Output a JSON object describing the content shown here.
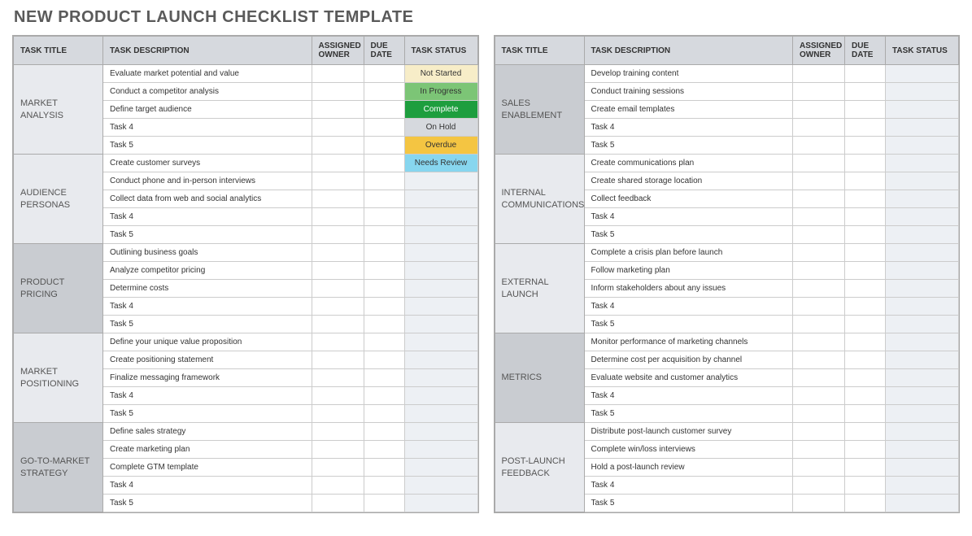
{
  "title": "NEW PRODUCT LAUNCH CHECKLIST TEMPLATE",
  "headers": {
    "task_title": "TASK TITLE",
    "task_desc": "TASK DESCRIPTION",
    "owner": "ASSIGNED OWNER",
    "due": "DUE DATE",
    "status": "TASK STATUS"
  },
  "status_labels": {
    "not_started": "Not Started",
    "in_progress": "In Progress",
    "complete": "Complete",
    "on_hold": "On Hold",
    "overdue": "Overdue",
    "needs_review": "Needs Review"
  },
  "left_sections": [
    {
      "title": "MARKET ANALYSIS",
      "alt": false,
      "tasks": [
        {
          "desc": "Evaluate market potential and value",
          "status": "not_started"
        },
        {
          "desc": "Conduct a competitor analysis",
          "status": "in_progress"
        },
        {
          "desc": "Define target audience",
          "status": "complete"
        },
        {
          "desc": "Task 4",
          "status": "on_hold"
        },
        {
          "desc": "Task 5",
          "status": "overdue"
        }
      ]
    },
    {
      "title": "AUDIENCE PERSONAS",
      "alt": false,
      "tasks": [
        {
          "desc": "Create customer surveys",
          "status": "needs_review"
        },
        {
          "desc": "Conduct phone and in-person interviews",
          "status": ""
        },
        {
          "desc": "Collect data from web and social analytics",
          "status": ""
        },
        {
          "desc": "Task 4",
          "status": ""
        },
        {
          "desc": "Task 5",
          "status": ""
        }
      ]
    },
    {
      "title": "PRODUCT PRICING",
      "alt": true,
      "tasks": [
        {
          "desc": "Outlining business goals",
          "status": ""
        },
        {
          "desc": "Analyze competitor pricing",
          "status": ""
        },
        {
          "desc": "Determine costs",
          "status": ""
        },
        {
          "desc": "Task 4",
          "status": ""
        },
        {
          "desc": "Task 5",
          "status": ""
        }
      ]
    },
    {
      "title": "MARKET POSITIONING",
      "alt": false,
      "tasks": [
        {
          "desc": "Define your unique value proposition",
          "status": ""
        },
        {
          "desc": "Create positioning statement",
          "status": ""
        },
        {
          "desc": "Finalize messaging framework",
          "status": ""
        },
        {
          "desc": "Task 4",
          "status": ""
        },
        {
          "desc": "Task 5",
          "status": ""
        }
      ]
    },
    {
      "title": "GO-TO-MARKET STRATEGY",
      "alt": true,
      "tasks": [
        {
          "desc": "Define sales strategy",
          "status": ""
        },
        {
          "desc": "Create marketing plan",
          "status": ""
        },
        {
          "desc": "Complete GTM template",
          "status": ""
        },
        {
          "desc": "Task 4",
          "status": ""
        },
        {
          "desc": "Task 5",
          "status": ""
        }
      ]
    }
  ],
  "right_sections": [
    {
      "title": "SALES ENABLEMENT",
      "alt": true,
      "tasks": [
        {
          "desc": "Develop training content",
          "status": ""
        },
        {
          "desc": "Conduct training sessions",
          "status": ""
        },
        {
          "desc": "Create email templates",
          "status": ""
        },
        {
          "desc": "Task 4",
          "status": ""
        },
        {
          "desc": "Task 5",
          "status": ""
        }
      ]
    },
    {
      "title": "INTERNAL COMMUNICATIONS",
      "alt": false,
      "tasks": [
        {
          "desc": "Create communications plan",
          "status": ""
        },
        {
          "desc": "Create shared storage location",
          "status": ""
        },
        {
          "desc": "Collect feedback",
          "status": ""
        },
        {
          "desc": "Task 4",
          "status": ""
        },
        {
          "desc": "Task 5",
          "status": ""
        }
      ]
    },
    {
      "title": "EXTERNAL LAUNCH",
      "alt": false,
      "tasks": [
        {
          "desc": "Complete a crisis plan before launch",
          "status": ""
        },
        {
          "desc": "Follow marketing plan",
          "status": ""
        },
        {
          "desc": "Inform stakeholders about any issues",
          "status": ""
        },
        {
          "desc": "Task 4",
          "status": ""
        },
        {
          "desc": "Task 5",
          "status": ""
        }
      ]
    },
    {
      "title": "METRICS",
      "alt": true,
      "tasks": [
        {
          "desc": "Monitor performance of marketing channels",
          "status": ""
        },
        {
          "desc": "Determine cost per acquisition by channel",
          "status": ""
        },
        {
          "desc": "Evaluate website and customer analytics",
          "status": ""
        },
        {
          "desc": "Task 4",
          "status": ""
        },
        {
          "desc": "Task 5",
          "status": ""
        }
      ]
    },
    {
      "title": "POST-LAUNCH FEEDBACK",
      "alt": false,
      "tasks": [
        {
          "desc": "Distribute post-launch customer survey",
          "status": ""
        },
        {
          "desc": "Complete win/loss interviews",
          "status": ""
        },
        {
          "desc": "Hold a post-launch review",
          "status": ""
        },
        {
          "desc": "Task 4",
          "status": ""
        },
        {
          "desc": "Task 5",
          "status": ""
        }
      ]
    }
  ]
}
